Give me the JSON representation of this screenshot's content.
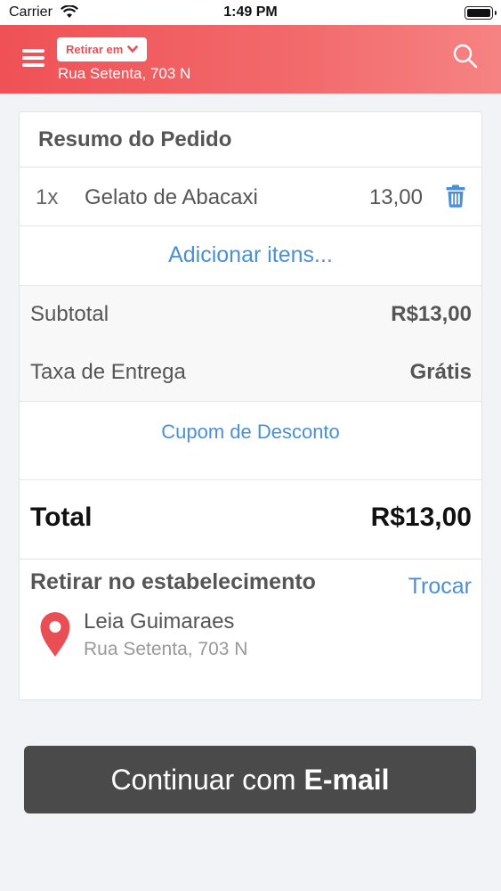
{
  "status_bar": {
    "carrier": "Carrier",
    "time": "1:49 PM"
  },
  "header": {
    "mode_label": "Retirar em",
    "address": "Rua Setenta, 703 N",
    "icons": [
      "menu-icon",
      "chevron-down-icon",
      "search-icon"
    ]
  },
  "order": {
    "title": "Resumo do Pedido",
    "items": [
      {
        "qty": "1x",
        "name": "Gelato de Abacaxi",
        "price": "13,00"
      }
    ],
    "add_items_label": "Adicionar itens...",
    "subtotal_label": "Subtotal",
    "subtotal_value": "R$13,00",
    "delivery_label": "Taxa de Entrega",
    "delivery_value": "Grátis",
    "coupon_label": "Cupom de Desconto",
    "total_label": "Total",
    "total_value": "R$13,00"
  },
  "pickup": {
    "title": "Retirar no estabelecimento",
    "change_label": "Trocar",
    "store_name": "Leia Guimaraes",
    "store_address": "Rua Setenta, 703 N"
  },
  "continue_button": {
    "prefix": "Continuar com",
    "bold": "E-mail"
  },
  "colors": {
    "header_start": "#ef5156",
    "header_end": "#f68383",
    "link": "#4a90d9",
    "pin": "#e94e55",
    "button": "#4a4a4a"
  }
}
